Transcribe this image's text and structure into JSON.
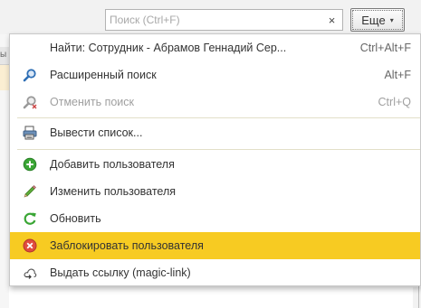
{
  "search": {
    "placeholder": "Поиск (Ctrl+F)",
    "value": "",
    "clear_label": "×"
  },
  "more_button": {
    "label": "Еще",
    "caret": "▾"
  },
  "background": {
    "column_fragment": "ы"
  },
  "menu": {
    "items": [
      {
        "label": "Найти: Сотрудник - Абрамов Геннадий Сер...",
        "shortcut": "Ctrl+Alt+F",
        "icon": "none",
        "enabled": true
      },
      {
        "label": "Расширенный поиск",
        "shortcut": "Alt+F",
        "icon": "search-icon",
        "enabled": true
      },
      {
        "label": "Отменить поиск",
        "shortcut": "Ctrl+Q",
        "icon": "cancel-search-icon",
        "enabled": false
      },
      {
        "label": "Вывести список...",
        "shortcut": "",
        "icon": "print-list-icon",
        "enabled": true
      },
      {
        "label": "Добавить пользователя",
        "shortcut": "",
        "icon": "add-icon",
        "enabled": true
      },
      {
        "label": "Изменить пользователя",
        "shortcut": "",
        "icon": "edit-pencil-icon",
        "enabled": true
      },
      {
        "label": "Обновить",
        "shortcut": "",
        "icon": "refresh-icon",
        "enabled": true
      },
      {
        "label": "Заблокировать пользователя",
        "shortcut": "",
        "icon": "block-icon",
        "enabled": true,
        "highlighted": true
      },
      {
        "label": "Выдать ссылку (magic-link)",
        "shortcut": "",
        "icon": "link-icon",
        "enabled": true
      }
    ]
  },
  "colors": {
    "highlight": "#f7cb22",
    "add_icon": "#3aa635",
    "block_icon": "#e04b3f",
    "search_icon": "#2f6fb5",
    "refresh_icon": "#3aa635"
  }
}
